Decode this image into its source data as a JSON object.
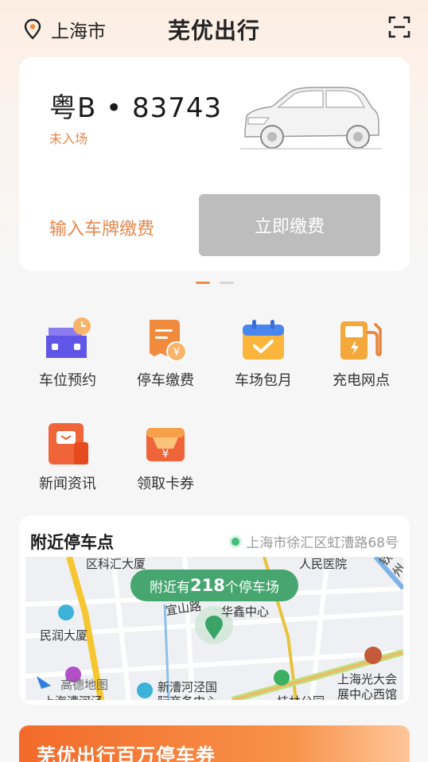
{
  "header": {
    "city": "上海市",
    "title": "芜优出行"
  },
  "car_card": {
    "plate": "粤B • 83743",
    "status": "未入场",
    "input_plate_label": "输入车牌缴费",
    "pay_label": "立即缴费"
  },
  "menu": [
    {
      "label": "车位预约",
      "icon": "parking-reserve-icon"
    },
    {
      "label": "停车缴费",
      "icon": "parking-pay-icon"
    },
    {
      "label": "车场包月",
      "icon": "monthly-calendar-icon"
    },
    {
      "label": "充电网点",
      "icon": "charging-station-icon"
    },
    {
      "label": "新闻资讯",
      "icon": "news-icon"
    },
    {
      "label": "领取卡券",
      "icon": "coupon-icon"
    }
  ],
  "nearby": {
    "title": "附近停车点",
    "address": "上海市徐汇区虹漕路68号",
    "count_prefix": "附近有",
    "count": "218",
    "count_suffix": "个停车场",
    "map_labels": {
      "l1": "区科汇大厦",
      "l2": "人民医院",
      "l3": "钦州路",
      "l4": "宜山路",
      "l5": "华鑫中心",
      "l6": "民润大厦",
      "l7": "高德地图",
      "l8": "新漕河泾国",
      "l9": "上海光大会",
      "l10": "展中心西馆",
      "l11": "际商务中心",
      "l12": "桂林公园",
      "l13": "上海漕河泾"
    }
  },
  "banner": {
    "text": "芜优出行百万停车券"
  },
  "colors": {
    "accent": "#e8874b",
    "pay_disabled": "#bdbdbd",
    "map_pill": "#47a670"
  }
}
